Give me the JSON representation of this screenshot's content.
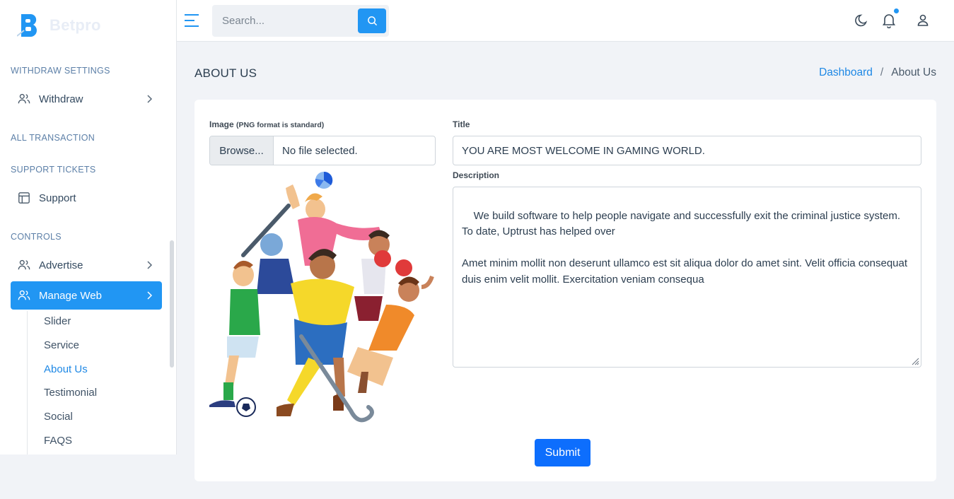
{
  "brand": {
    "name": "Betpro",
    "color": "#2196f3"
  },
  "sidebar": {
    "sections": [
      {
        "heading": "WITHDRAW SETTINGS"
      },
      {
        "heading": "ALL TRANSACTION"
      },
      {
        "heading": "SUPPORT TICKETS"
      },
      {
        "heading": "CONTROLS"
      }
    ],
    "items": {
      "withdraw": {
        "label": "Withdraw",
        "icon": "users-icon"
      },
      "support": {
        "label": "Support",
        "icon": "layout-icon"
      },
      "advertise": {
        "label": "Advertise",
        "icon": "users-icon"
      },
      "manage_web": {
        "label": "Manage Web",
        "icon": "users-icon",
        "active": true
      }
    },
    "submenu": [
      "Slider",
      "Service",
      "About Us",
      "Testimonial",
      "Social",
      "FAQS"
    ],
    "current_submenu": "About Us"
  },
  "topbar": {
    "search_placeholder": "Search...",
    "icons": [
      "menu-icon",
      "search-icon",
      "moon-icon",
      "bell-icon",
      "user-icon"
    ]
  },
  "page": {
    "title": "ABOUT US",
    "breadcrumb": {
      "home": "Dashboard",
      "separator": "/",
      "current": "About Us"
    }
  },
  "form": {
    "image_label": "Image",
    "image_hint": "(PNG format is standard)",
    "browse_label": "Browse...",
    "file_status": "No file selected.",
    "title_label": "Title",
    "title_value": "YOU ARE MOST WELCOME IN GAMING WORLD.",
    "description_label": "Description",
    "description_value": "We build software to help people navigate and successfully exit the criminal justice system. To date, Uptrust has helped over\n\nAmet minim mollit non deserunt ullamco est sit aliqua dolor do amet sint. Velit officia consequat duis enim velit mollit. Exercitation veniam consequa",
    "submit_label": "Submit"
  }
}
